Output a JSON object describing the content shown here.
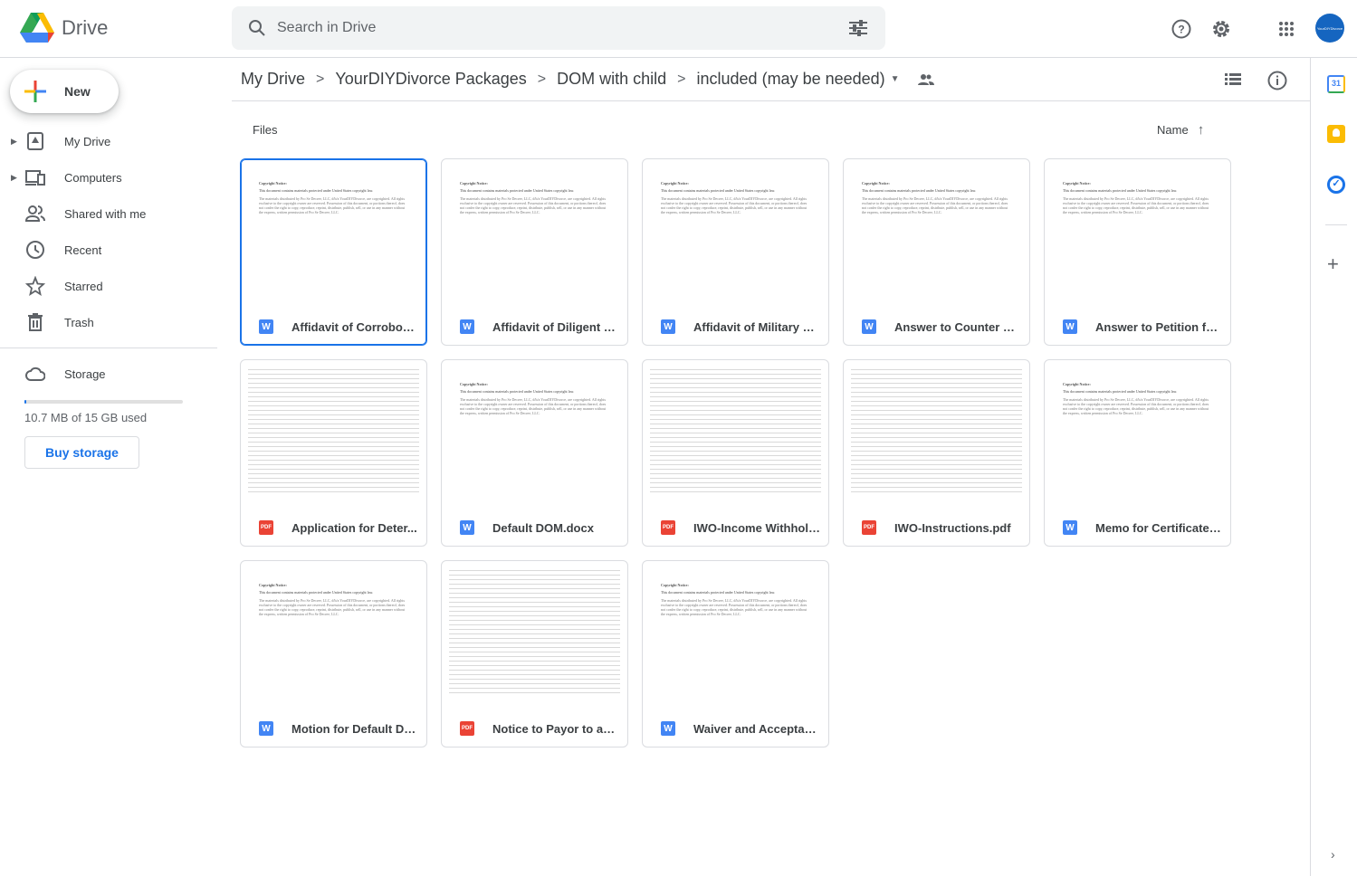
{
  "app": {
    "name": "Drive",
    "avatar_text": "YourDIYDivorce"
  },
  "search": {
    "placeholder": "Search in Drive"
  },
  "sidebar": {
    "new_label": "New",
    "items": [
      {
        "label": "My Drive",
        "icon": "my-drive-icon",
        "expandable": true
      },
      {
        "label": "Computers",
        "icon": "computer-icon",
        "expandable": true
      },
      {
        "label": "Shared with me",
        "icon": "people-icon",
        "expandable": false
      },
      {
        "label": "Recent",
        "icon": "clock-icon",
        "expandable": false
      },
      {
        "label": "Starred",
        "icon": "star-icon",
        "expandable": false
      },
      {
        "label": "Trash",
        "icon": "trash-icon",
        "expandable": false
      }
    ],
    "storage": {
      "label": "Storage",
      "used_text": "10.7 MB of 15 GB used",
      "used_fraction": 0.0007,
      "buy_label": "Buy storage"
    }
  },
  "breadcrumb": [
    "My Drive",
    "YourDIYDivorce Packages",
    "DOM with child",
    "included (may be needed)"
  ],
  "files": {
    "section_label": "Files",
    "sort_label": "Name",
    "thumb_notice": {
      "title": "Copyright Notice:",
      "line1": "This document contains materials protected under United States copyright law.",
      "body": "The materials distributed by Pro Se Decree, LLC, d/b/a YourDIYDivorce, are copyrighted. All rights exclusive to the copyright owner are reserved. Possession of this document, or portions thereof, does not confer the right to copy, reproduce, reprint, distribute, publish, sell, or use in any manner without the express, written permission of Pro Se Decree, LLC."
    },
    "items": [
      {
        "name": "Affidavit of Corroborating Witness.docx",
        "display": "Affidavit of Corrobora...",
        "type": "word",
        "thumb": "notice",
        "selected": true
      },
      {
        "name": "Affidavit of Diligent Search.docx",
        "display": "Affidavit of Diligent S...",
        "type": "word",
        "thumb": "notice"
      },
      {
        "name": "Affidavit of Military Status.docx",
        "display": "Affidavit of Military S...",
        "type": "word",
        "thumb": "notice"
      },
      {
        "name": "Answer to Counter Petition.docx",
        "display": "Answer to Counter Pe...",
        "type": "word",
        "thumb": "notice"
      },
      {
        "name": "Answer to Petition for Divorce.docx",
        "display": "Answer to Petition for...",
        "type": "word",
        "thumb": "notice"
      },
      {
        "name": "Application for Determination.pdf",
        "display": "Application for Deter...",
        "type": "pdf",
        "thumb": "form"
      },
      {
        "name": "Default DOM.docx",
        "display": "Default DOM.docx",
        "type": "word",
        "thumb": "notice"
      },
      {
        "name": "IWO-Income Withholding for Support.pdf",
        "display": "IWO-Income Withhold...",
        "type": "pdf",
        "thumb": "form"
      },
      {
        "name": "IWO-Instructions.pdf",
        "display": "IWO-Instructions.pdf",
        "type": "pdf",
        "thumb": "form"
      },
      {
        "name": "Memo for Certificate of Default.docx",
        "display": "Memo for Certificate ...",
        "type": "word",
        "thumb": "notice"
      },
      {
        "name": "Motion for Default DOM.docx",
        "display": "Motion for Default DO...",
        "type": "word",
        "thumb": "notice"
      },
      {
        "name": "Notice to Payor to accompany IWO.pdf",
        "display": "Notice to Payor to acc...",
        "type": "pdf",
        "thumb": "form"
      },
      {
        "name": "Waiver and Acceptance of Service.docx",
        "display": "Waiver and Acceptan...",
        "type": "word",
        "thumb": "notice"
      }
    ]
  }
}
